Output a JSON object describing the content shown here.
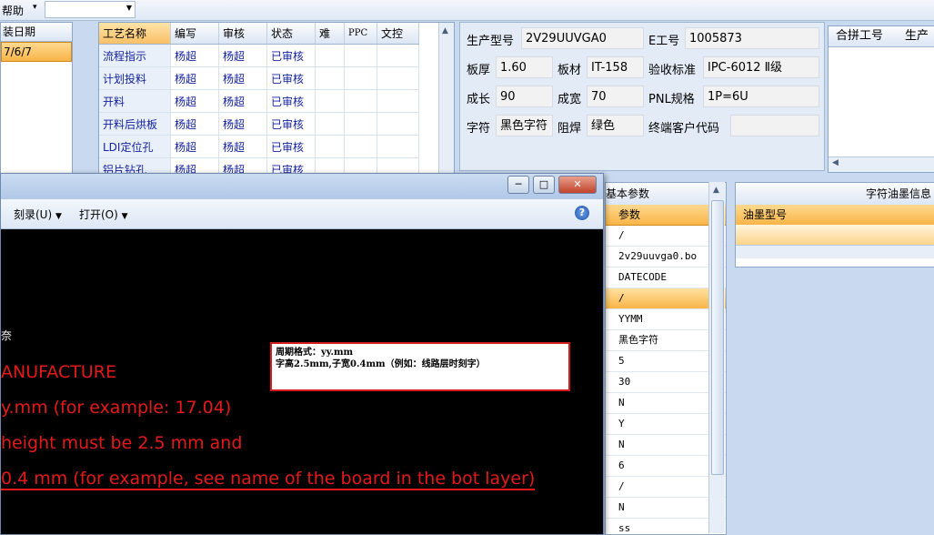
{
  "menu": {
    "help": "帮助",
    "arrow": "▾",
    "combo_value": ""
  },
  "date_panel": {
    "header": "装日期",
    "selected_value": "7/6/7"
  },
  "process_grid": {
    "columns": [
      "工艺名称",
      "编写",
      "审核",
      "状态",
      "难",
      "PPC",
      "文控"
    ],
    "rows": [
      [
        "流程指示",
        "杨超",
        "杨超",
        "已审核",
        "",
        "",
        ""
      ],
      [
        "计划投料",
        "杨超",
        "杨超",
        "已审核",
        "",
        "",
        ""
      ],
      [
        "开料",
        "杨超",
        "杨超",
        "已审核",
        "",
        "",
        ""
      ],
      [
        "开料后烘板",
        "杨超",
        "杨超",
        "已审核",
        "",
        "",
        ""
      ],
      [
        "LDI定位孔",
        "杨超",
        "杨超",
        "已审核",
        "",
        "",
        ""
      ],
      [
        "铝片钻孔",
        "杨超",
        "杨超",
        "已审核",
        "",
        "",
        ""
      ]
    ]
  },
  "product_info": {
    "model_label": "生产型号",
    "model_value": "2V29UUVGA0",
    "eno_label": "E工号",
    "eno_value": "1005873",
    "thickness_label": "板厚",
    "thickness_value": "1.60",
    "material_label": "板材",
    "material_value": "IT-158",
    "standard_label": "验收标准",
    "standard_value": "IPC-6012 Ⅱ级",
    "length_label": "成长",
    "length_value": "90",
    "width_label": "成宽",
    "width_value": "70",
    "pnl_label": "PNL规格",
    "pnl_value": "1P=6U",
    "char_label": "字符",
    "char_value": "黑色字符",
    "mask_label": "阻焊",
    "mask_value": "绿色",
    "customer_label": "终端客户代码",
    "customer_value": ""
  },
  "merge_panel": {
    "col1": "合拼工号",
    "col2": "生产"
  },
  "params": {
    "title": "基本参数",
    "column": "参数",
    "values": [
      "/",
      "2v29uuvga0.bo",
      "DATECODE",
      "/",
      "YYMM",
      "黑色字符",
      "5",
      "30",
      "N",
      "Y",
      "N",
      "6",
      "/",
      "N",
      "ss"
    ],
    "selected_index": 3
  },
  "ink_panel": {
    "title": "字符油墨信息",
    "column": "油墨型号"
  },
  "viewer": {
    "menu_burn": "刻录(U)",
    "menu_open": "打开(O)",
    "help": "?",
    "btn_min": "─",
    "btn_max": "□",
    "btn_close": "✕",
    "canvas_lines": [
      "ANUFACTURE",
      "y.mm (for example: 17.04)",
      "height must be 2.5 mm and",
      "0.4 mm (for example, see name of the board in the bot  layer)"
    ],
    "stray_glyph": "奈",
    "note_line1": "周期格式：yy.mm",
    "note_line2": "字高2.5mm,子宽0.4mm（例如：线路层时刻字）"
  }
}
